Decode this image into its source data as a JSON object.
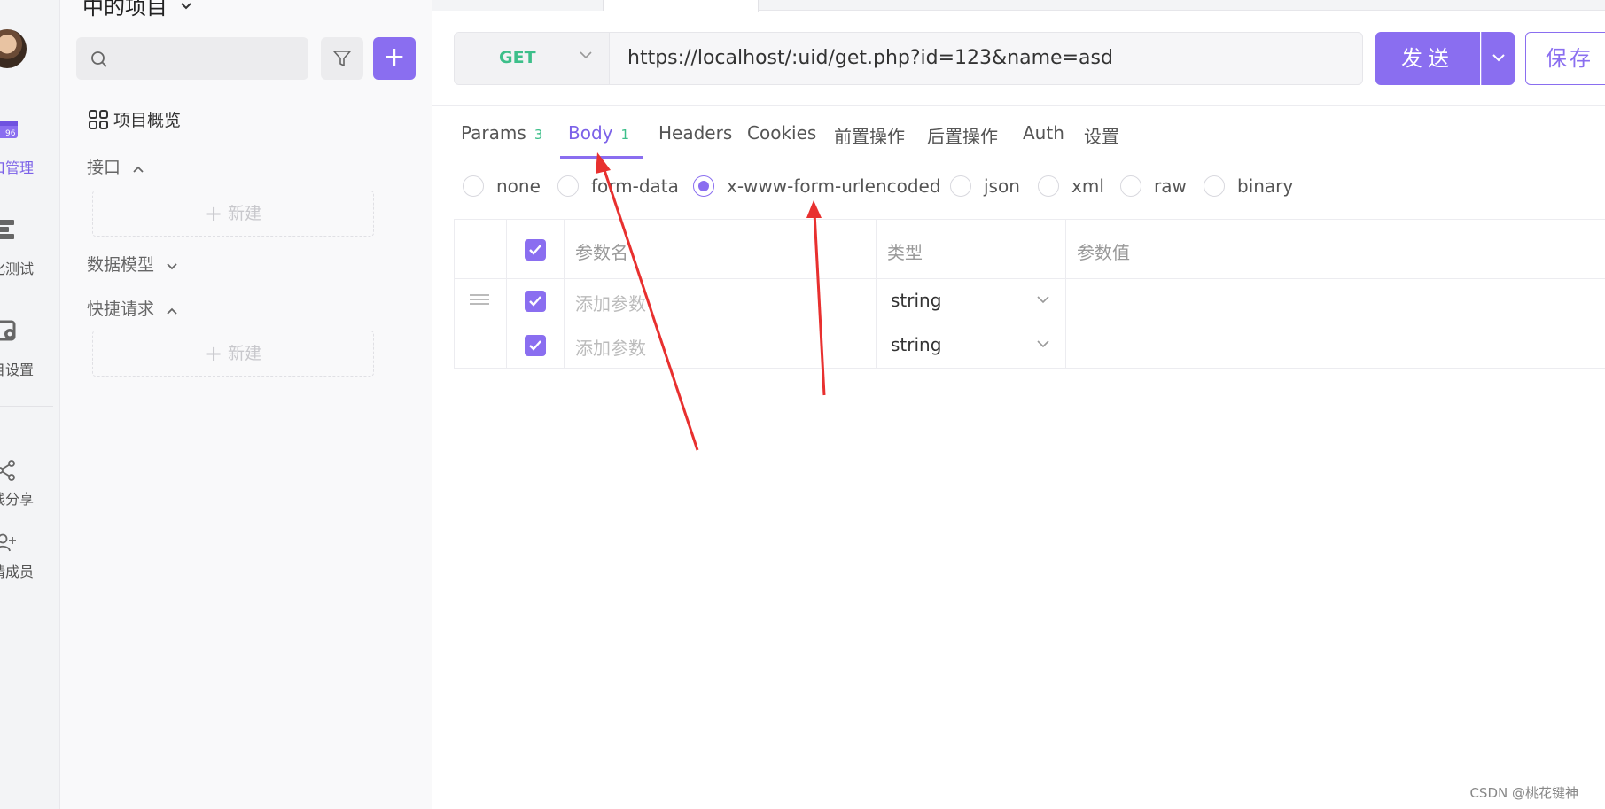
{
  "rail": {
    "items": [
      {
        "label": "口管理",
        "icon": "api-management-icon",
        "active": true
      },
      {
        "label": "化测试",
        "icon": "automation-test-icon",
        "active": false
      },
      {
        "label": "目设置",
        "icon": "project-settings-icon",
        "active": false
      },
      {
        "label": "线分享",
        "icon": "share-icon",
        "active": false
      },
      {
        "label": "请成员",
        "icon": "invite-member-icon",
        "active": false
      }
    ]
  },
  "tree": {
    "project_title": "中的项目",
    "overview_label": "项目概览",
    "groups": {
      "interfaces": {
        "label": "接口",
        "new_label": "新建"
      },
      "data_models": {
        "label": "数据模型"
      },
      "quick_requests": {
        "label": "快捷请求",
        "new_label": "新建"
      }
    }
  },
  "request": {
    "method": "GET",
    "url": "https://localhost/:uid/get.php?id=123&name=asd",
    "send_label": "发送",
    "save_label": "保存"
  },
  "tabs": [
    {
      "label": "Params",
      "count": "3",
      "active": false
    },
    {
      "label": "Body",
      "count": "1",
      "active": true
    },
    {
      "label": "Headers",
      "count": "",
      "active": false
    },
    {
      "label": "Cookies",
      "count": "",
      "active": false
    },
    {
      "label": "前置操作",
      "count": "",
      "active": false
    },
    {
      "label": "后置操作",
      "count": "",
      "active": false
    },
    {
      "label": "Auth",
      "count": "",
      "active": false
    },
    {
      "label": "设置",
      "count": "",
      "active": false
    }
  ],
  "body_types": [
    {
      "label": "none",
      "selected": false
    },
    {
      "label": "form-data",
      "selected": false
    },
    {
      "label": "x-www-form-urlencoded",
      "selected": true
    },
    {
      "label": "json",
      "selected": false
    },
    {
      "label": "xml",
      "selected": false
    },
    {
      "label": "raw",
      "selected": false
    },
    {
      "label": "binary",
      "selected": false
    }
  ],
  "table": {
    "headers": {
      "name": "参数名",
      "type": "类型",
      "value": "参数值"
    },
    "rows": [
      {
        "name_placeholder": "添加参数",
        "type": "string",
        "value": ""
      },
      {
        "name_placeholder": "添加参数",
        "type": "string",
        "value": ""
      }
    ]
  },
  "watermark": "CSDN @桃花键神",
  "colors": {
    "accent": "#8a6ef0",
    "method_get": "#3dbf8a",
    "annotation_arrow": "#e8302f"
  }
}
